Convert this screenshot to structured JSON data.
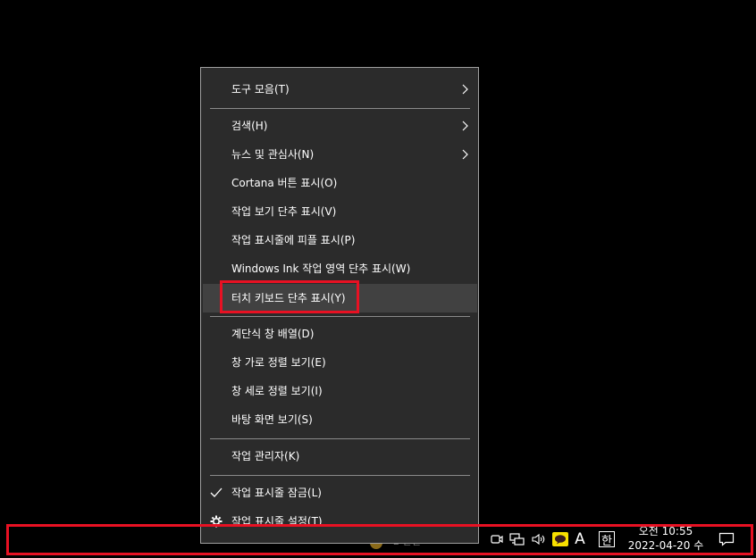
{
  "context_menu": {
    "items": [
      {
        "label": "도구 모음(T)",
        "submenu": true
      },
      {
        "label": "검색(H)",
        "submenu": true
      },
      {
        "label": "뉴스 및 관심사(N)",
        "submenu": true
      },
      {
        "label": "Cortana 버튼 표시(O)"
      },
      {
        "label": "작업 보기 단추 표시(V)"
      },
      {
        "label": "작업 표시줄에 피플 표시(P)"
      },
      {
        "label": "Windows Ink 작업 영역 단추 표시(W)"
      },
      {
        "label": "터치 키보드 단추 표시(Y)",
        "highlighted": true
      },
      {
        "label": "계단식 창 배열(D)"
      },
      {
        "label": "창 가로 정렬 보기(E)"
      },
      {
        "label": "창 세로 정렬 보기(I)"
      },
      {
        "label": "바탕 화면 보기(S)"
      },
      {
        "label": "작업 관리자(K)"
      },
      {
        "label": "작업 표시줄 잠금(L)",
        "checked": true
      },
      {
        "label": "작업 표시줄 설정(T)",
        "icon": "gear-icon"
      }
    ]
  },
  "taskbar": {
    "ghost_text": "2 관련",
    "tray_icons": [
      "meet-now-icon",
      "network-icon",
      "volume-icon",
      "kakaotalk-icon",
      "ime-mode-icon",
      "ime-hangul-icon"
    ],
    "ime_mode_label": "A",
    "ime_hangul_label": "한",
    "clock": {
      "time": "오전 10:55",
      "date": "2022-04-20 수"
    },
    "notification_icon": "action-center-icon"
  },
  "colors": {
    "menu_bg": "#2b2b2b",
    "menu_highlight": "#414141",
    "annotation_red": "#e81123",
    "kakao_yellow": "#f9e000"
  }
}
